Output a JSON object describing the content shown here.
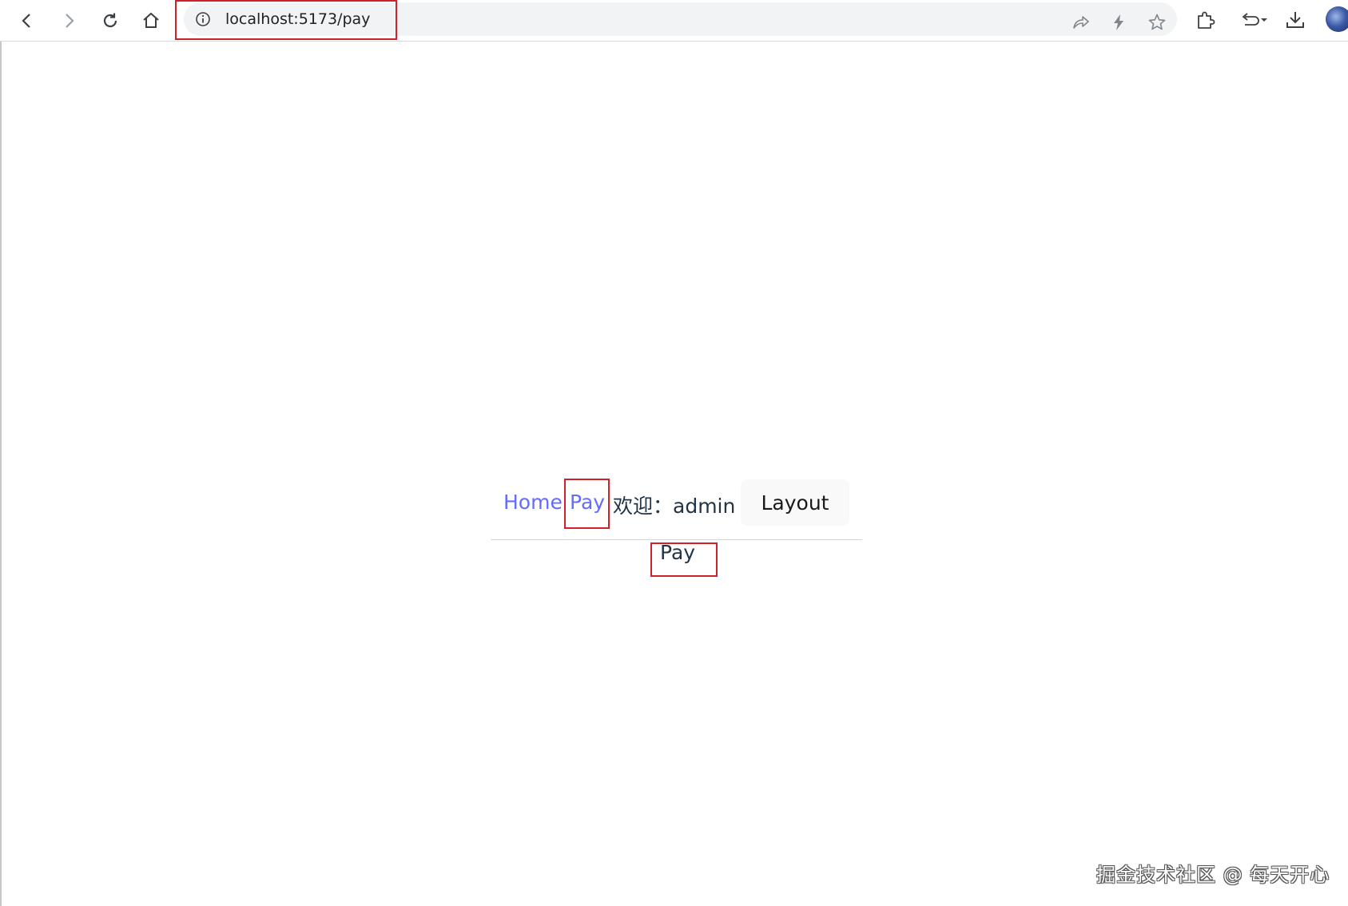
{
  "browser": {
    "url": "localhost:5173/pay",
    "icons": {
      "back": "arrow-left-icon",
      "forward": "arrow-right-icon",
      "reload": "reload-icon",
      "home": "home-icon",
      "site_info": "info-circle-icon",
      "share": "share-icon",
      "lightning": "lightning-icon",
      "bookmark": "star-icon",
      "extensions": "puzzle-icon",
      "history": "undo-icon",
      "download": "download-icon",
      "profile": "avatar"
    }
  },
  "app": {
    "nav": {
      "home_label": "Home",
      "pay_label": "Pay",
      "welcome_text": "欢迎：admin",
      "layout_button_label": "Layout"
    },
    "view_heading": "Pay"
  },
  "watermark": "掘金技术社区 @ 每天开心",
  "colors": {
    "link": "#646cff",
    "text": "#213547",
    "annotation": "#d0202a",
    "omnibox_bg": "#f1f3f4"
  }
}
